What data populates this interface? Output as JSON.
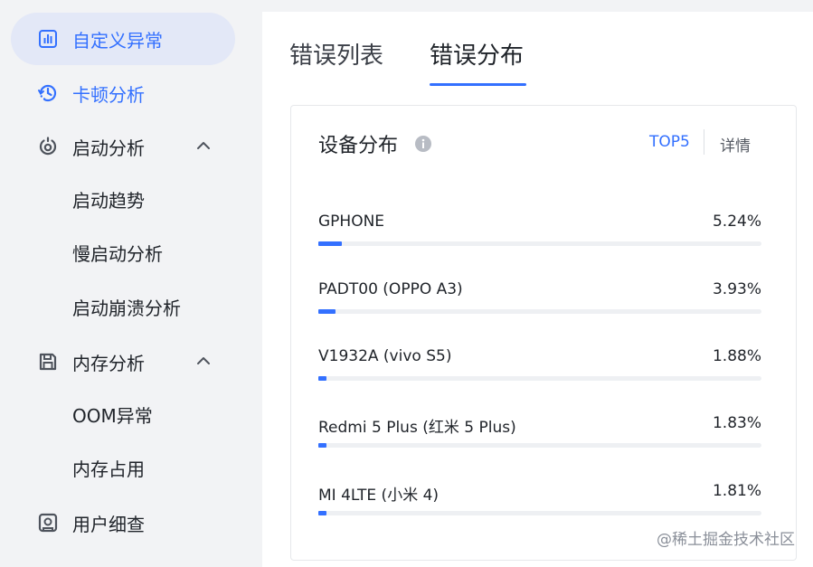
{
  "sidebar": {
    "items": [
      {
        "label": "自定义异常",
        "icon": "bar-chart-icon",
        "active": true
      },
      {
        "label": "卡顿分析",
        "icon": "clock-refresh-icon"
      },
      {
        "label": "启动分析",
        "icon": "power-icon",
        "expanded": true
      },
      {
        "label": "内存分析",
        "icon": "save-disk-icon",
        "expanded": true
      },
      {
        "label": "用户细查",
        "icon": "user-search-icon"
      }
    ],
    "sub_startup": [
      "启动趋势",
      "慢启动分析",
      "启动崩溃分析"
    ],
    "sub_memory": [
      "OOM异常",
      "内存占用"
    ]
  },
  "tabs": {
    "list": "错误列表",
    "distribution": "错误分布"
  },
  "card": {
    "title": "设备分布",
    "top5": "TOP5",
    "detail": "详情",
    "rows": [
      {
        "name": "GPHONE",
        "percent": "5.24%",
        "value": 5.24
      },
      {
        "name": "PADT00 (OPPO A3)",
        "percent": "3.93%",
        "value": 3.93
      },
      {
        "name": "V1932A (vivo S5)",
        "percent": "1.88%",
        "value": 1.88
      },
      {
        "name": "Redmi 5 Plus (红米 5 Plus)",
        "percent": "1.83%",
        "value": 1.83
      },
      {
        "name": "MI 4LTE (小米 4)",
        "percent": "1.81%",
        "value": 1.81
      }
    ]
  },
  "watermark": "@稀土掘金技术社区",
  "colors": {
    "accent": "#3370ff",
    "active_bg": "#e3e8f7"
  }
}
